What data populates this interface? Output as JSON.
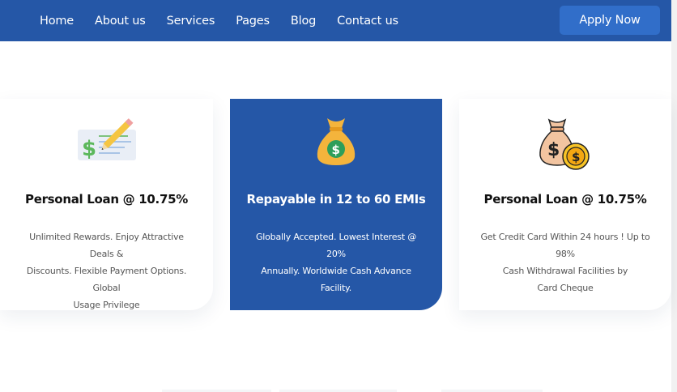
{
  "nav": {
    "items": [
      "Home",
      "About us",
      "Services",
      "Pages",
      "Blog",
      "Contact us"
    ],
    "cta_label": "Apply Now"
  },
  "cards": [
    {
      "icon": "check-pencil-icon",
      "title": "Personal Loan @ 10.75%",
      "lines": [
        "Unlimited Rewards. Enjoy Attractive Deals &",
        "Discounts. Flexible Payment Options. Global",
        "Usage Privilege"
      ]
    },
    {
      "icon": "money-bag-icon",
      "title": "Repayable in 12 to 60 EMIs",
      "lines": [
        "Globally Accepted. Lowest Interest @ 20%",
        "Annually. Worldwide Cash Advance",
        "Facility."
      ]
    },
    {
      "icon": "money-bag-coin-icon",
      "title": "Personal Loan @ 10.75%",
      "lines": [
        "Get Credit Card Within 24 hours ! Up to 98%",
        "Cash Withdrawal Facilities by",
        "Card Cheque"
      ]
    }
  ],
  "colors": {
    "primary": "#2557a7",
    "button": "#316ec9",
    "heading": "#111111",
    "body_text": "#555555"
  }
}
